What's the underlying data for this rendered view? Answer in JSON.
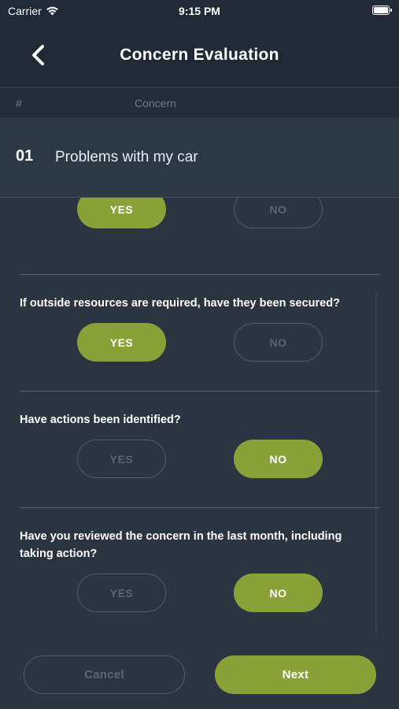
{
  "status_bar": {
    "carrier": "Carrier",
    "time": "9:15 PM"
  },
  "nav": {
    "title": "Concern Evaluation",
    "back_icon": "chevron-left-icon"
  },
  "table_header": {
    "number_col": "#",
    "concern_col": "Concern"
  },
  "concern": {
    "number": "01",
    "title": "Problems with my car"
  },
  "questions": [
    {
      "text": "",
      "yes_label": "YES",
      "no_label": "NO",
      "selected": "YES"
    },
    {
      "text": "If outside resources are required, have they been secured?",
      "yes_label": "YES",
      "no_label": "NO",
      "selected": "YES"
    },
    {
      "text": "Have actions been identified?",
      "yes_label": "YES",
      "no_label": "NO",
      "selected": "NO"
    },
    {
      "text": "Have you reviewed the concern in the last month, including taking action?",
      "yes_label": "YES",
      "no_label": "NO",
      "selected": "NO"
    }
  ],
  "actions": {
    "cancel_label": "Cancel",
    "next_label": "Next"
  },
  "colors": {
    "background": "#2b3541",
    "header": "#1f2a36",
    "accent": "#8aa13a",
    "inactive": "#5a6673"
  }
}
